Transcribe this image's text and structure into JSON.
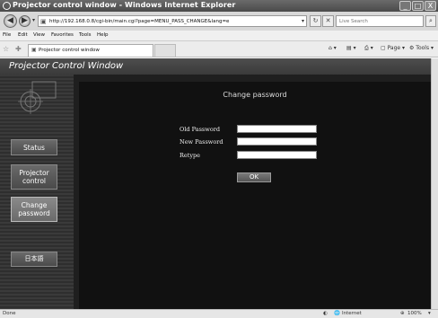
{
  "window": {
    "title": "Projector control window - Windows Internet Explorer",
    "min": "_",
    "max": "□",
    "close": "X"
  },
  "address": {
    "url": "http://192.168.0.8/cgi-bin/main.cgi?page=MENU_PASS_CHANGE&lang=e",
    "search_placeholder": "Live Search"
  },
  "menu": [
    "File",
    "Edit",
    "View",
    "Favorites",
    "Tools",
    "Help"
  ],
  "tab": {
    "label": "Projector control window"
  },
  "toolbar": {
    "page": "Page",
    "tools": "Tools"
  },
  "page": {
    "header_title": "Projector Control Window",
    "sidebar": {
      "status": "Status",
      "projector_control": "Projector control",
      "change_password": "Change password",
      "language": "日本語"
    },
    "content": {
      "title": "Change password",
      "old_password_label": "Old Password",
      "new_password_label": "New Password",
      "retype_label": "Retype",
      "ok_label": "OK"
    }
  },
  "statusbar": {
    "left": "Done",
    "zone": "Internet",
    "zoom": "100%"
  }
}
